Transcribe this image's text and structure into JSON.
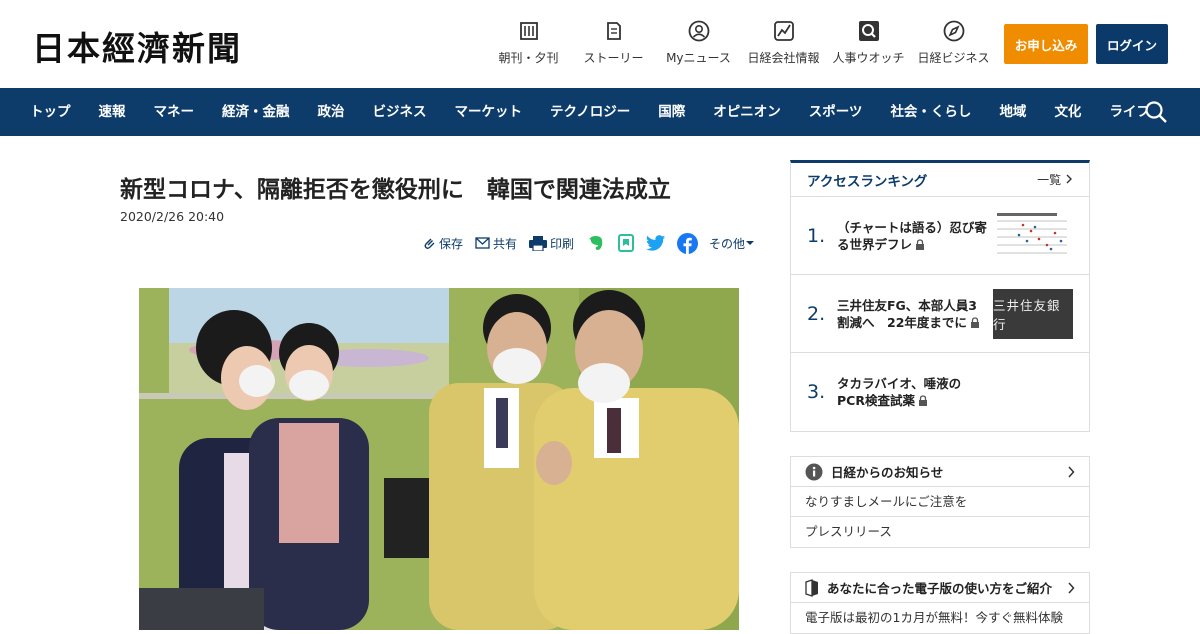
{
  "header": {
    "logo": "日本經濟新聞",
    "links": [
      {
        "label": "朝刊・夕刊",
        "icon": "newspaper-icon"
      },
      {
        "label": "ストーリー",
        "icon": "story-icon"
      },
      {
        "label": "Myニュース",
        "icon": "user-icon"
      },
      {
        "label": "日経会社情報",
        "icon": "chart-icon"
      },
      {
        "label": "人事ウオッチ",
        "icon": "search-person-icon"
      },
      {
        "label": "日経ビジネス",
        "icon": "compass-icon"
      }
    ],
    "apply_label": "お申し込み",
    "login_label": "ログイン",
    "apply_color": "#f08c00",
    "login_color": "#0b3a6a"
  },
  "nav": {
    "items": [
      "トップ",
      "速報",
      "マネー",
      "経済・金融",
      "政治",
      "ビジネス",
      "マーケット",
      "テクノロジー",
      "国際",
      "オピニオン",
      "スポーツ",
      "社会・くらし",
      "地域",
      "文化",
      "ライフ"
    ],
    "color": "#0d3c6b"
  },
  "article": {
    "title": "新型コロナ、隔離拒否を懲役刑に　韓国で関連法成立",
    "date": "2020/2/26 20:40",
    "share": {
      "save": "保存",
      "share": "共有",
      "print": "印刷",
      "more": "その他"
    }
  },
  "ranking": {
    "title": "アクセスランキング",
    "more": "一覧",
    "items": [
      {
        "rank": "1.",
        "text": "（チャートは語る）忍び寄る世界デフレ",
        "thumb": "chart"
      },
      {
        "rank": "2.",
        "text": "三井住友FG、本部人員3割減へ　22年度までに",
        "thumb": "三井住友銀行"
      },
      {
        "rank": "3.",
        "text": "タカラバイオ、唾液のPCR検査試薬",
        "thumb": ""
      }
    ]
  },
  "notice": {
    "title": "日経からのお知らせ",
    "items": [
      "なりすましメールにご注意を",
      "プレスリリース"
    ]
  },
  "guide": {
    "title": "あなたに合った電子版の使い方をご紹介",
    "items": [
      "電子版は最初の1カ月が無料！今すぐ無料体験"
    ]
  }
}
